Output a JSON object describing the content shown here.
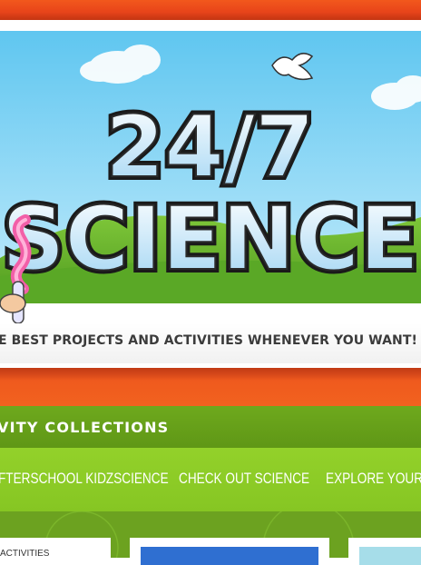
{
  "hero": {
    "title_line1": "24/7",
    "title_line2": "SCIENCE",
    "tagline": "E BEST PROJECTS AND ACTIVITIES WHENEVER YOU WANT!"
  },
  "collections": {
    "title": "VITY COLLECTIONS",
    "tabs": [
      {
        "label": "FTERSCHOOL KIDZSCIENCE"
      },
      {
        "label": "CHECK OUT SCIENCE"
      },
      {
        "label": "EXPLORE YOUR W"
      }
    ],
    "cards": [
      {
        "label": "ACTIVITIES"
      }
    ]
  },
  "colors": {
    "orange": "#ef5a1e",
    "green_dark": "#649d18",
    "green_light": "#8ecd27",
    "sky": "#7fd3f4"
  }
}
